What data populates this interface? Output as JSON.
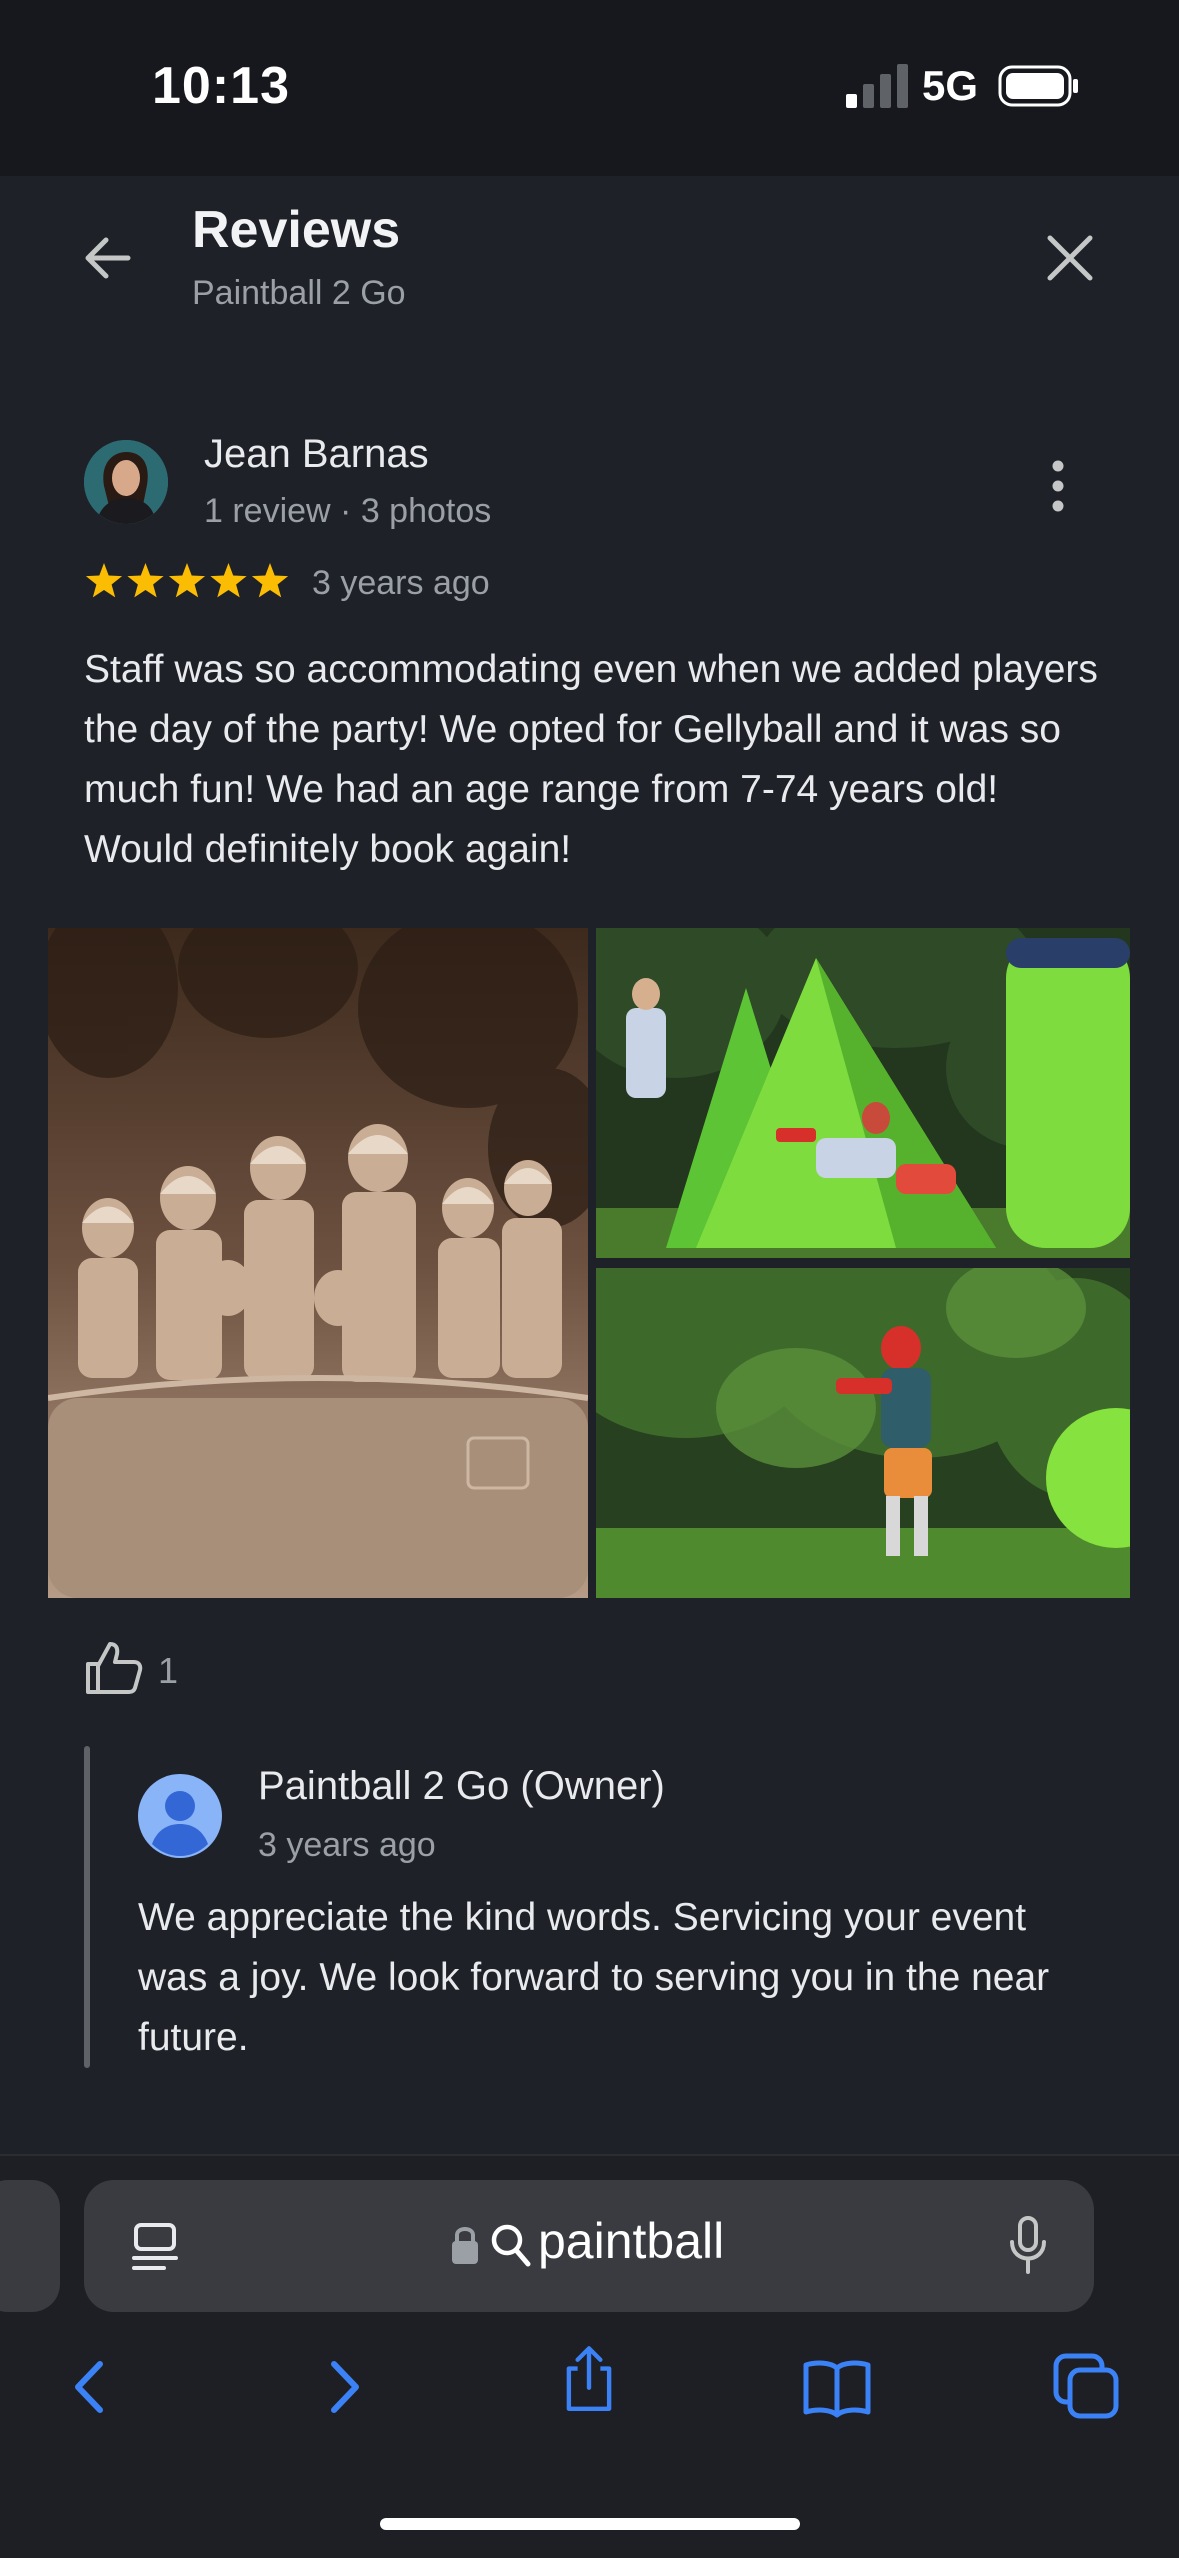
{
  "status_bar": {
    "time": "10:13",
    "network": "5G",
    "signal_bars_filled": 1,
    "signal_bars_total": 4
  },
  "header": {
    "title": "Reviews",
    "subtitle": "Paintball 2 Go"
  },
  "review": {
    "author": "Jean Barnas",
    "meta": "1 review · 3 photos",
    "rating": 5,
    "date": "3 years ago",
    "text": "Staff was so accommodating even when we added players the day of the party! We opted for Gellyball and it was so much fun! We had an age range from 7-74 years old! Would definitely book again!",
    "likes": "1",
    "photos": [
      "group-photo-sepia",
      "inflatable-bunkers-photo",
      "player-shooting-photo"
    ]
  },
  "owner_response": {
    "name": "Paintball 2 Go (Owner)",
    "date": "3 years ago",
    "text": "We appreciate the kind words. Servicing your event was a joy. We look forward to serving you in the near future."
  },
  "browser": {
    "url_text": "paintball"
  },
  "colors": {
    "accent": "#3b82f6",
    "star": "#fbbc04",
    "background": "#1f2129"
  }
}
